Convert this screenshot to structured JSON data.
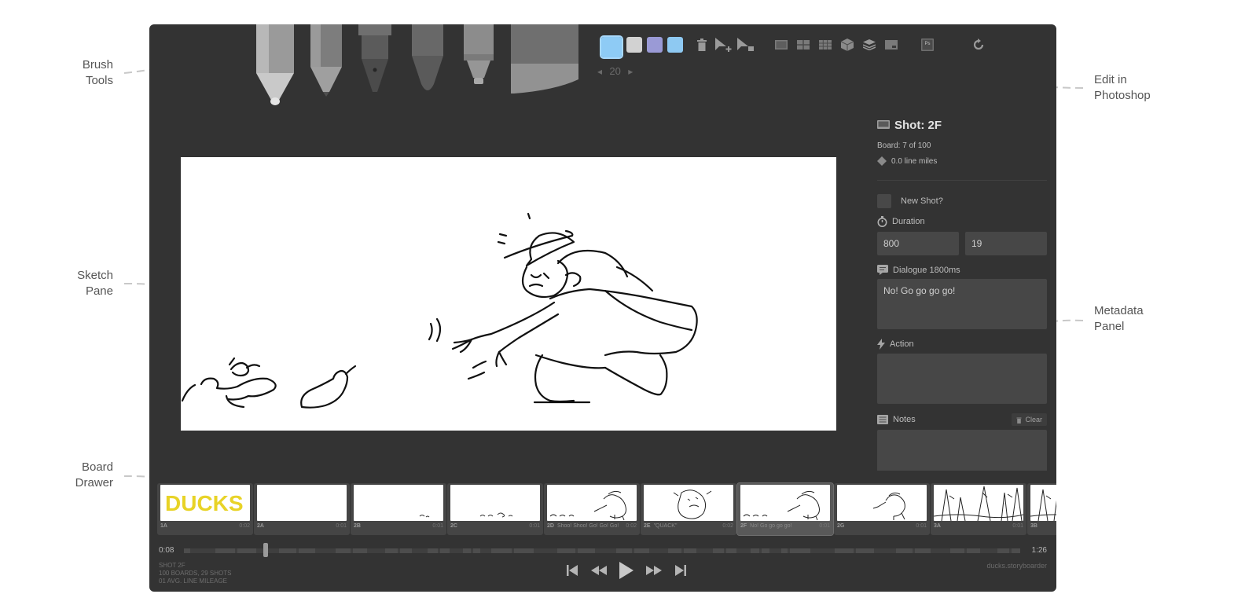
{
  "callouts": {
    "brush_tools": "Brush\nTools",
    "sketch_pane": "Sketch\nPane",
    "board_drawer": "Board\nDrawer",
    "edit_in_photoshop": "Edit in\nPhotoshop",
    "metadata_panel": "Metadata\nPanel"
  },
  "toolbar": {
    "brush_size": "20",
    "swatches": [
      "#8ecbf5",
      "#d2d2d2",
      "#9a9ad6",
      "#8ec9f2"
    ],
    "photoshop_label": "Ps"
  },
  "metadata": {
    "shot_title": "Shot: 2F",
    "board_position": "Board: 7 of 100",
    "line_miles": "0.0 line miles",
    "new_shot_label": "New Shot?",
    "duration_label": "Duration",
    "duration_ms": "800",
    "duration_frames": "19",
    "dialogue_label": "Dialogue 1800ms",
    "dialogue_text": "No! Go go go go!",
    "action_label": "Action",
    "action_text": "",
    "notes_label": "Notes",
    "clear_label": "Clear",
    "notes_text": ""
  },
  "boards": [
    {
      "label": "1A",
      "dialogue": "",
      "duration": "0:02",
      "kind": "ducks"
    },
    {
      "label": "2A",
      "dialogue": "",
      "duration": "0:01",
      "kind": "blank"
    },
    {
      "label": "2B",
      "dialogue": "",
      "duration": "0:01",
      "kind": "dots"
    },
    {
      "label": "2C",
      "dialogue": "",
      "duration": "0:01",
      "kind": "ducks-small"
    },
    {
      "label": "2D",
      "dialogue": "Shoo! Shoo! Go! Go! Go!",
      "duration": "0:02",
      "kind": "chase"
    },
    {
      "label": "2E",
      "dialogue": "\"QUACK\"",
      "duration": "0:02",
      "kind": "face"
    },
    {
      "label": "2F",
      "dialogue": "No! Go go go go!",
      "duration": "0:01",
      "kind": "chase",
      "active": true
    },
    {
      "label": "2G",
      "dialogue": "",
      "duration": "0:01",
      "kind": "reach"
    },
    {
      "label": "3A",
      "dialogue": "",
      "duration": "0:01",
      "kind": "trees"
    },
    {
      "label": "3B",
      "dialogue": "",
      "duration": "",
      "kind": "trees"
    }
  ],
  "timeline": {
    "start": "0:08",
    "end": "1:26",
    "playhead_fraction": 0.095
  },
  "stats": {
    "line1": "SHOT 2F",
    "line2": "100 BOARDS, 29 SHOTS",
    "line3": "01 AVG. LINE MILEAGE"
  },
  "site": "ducks.storyboarder"
}
